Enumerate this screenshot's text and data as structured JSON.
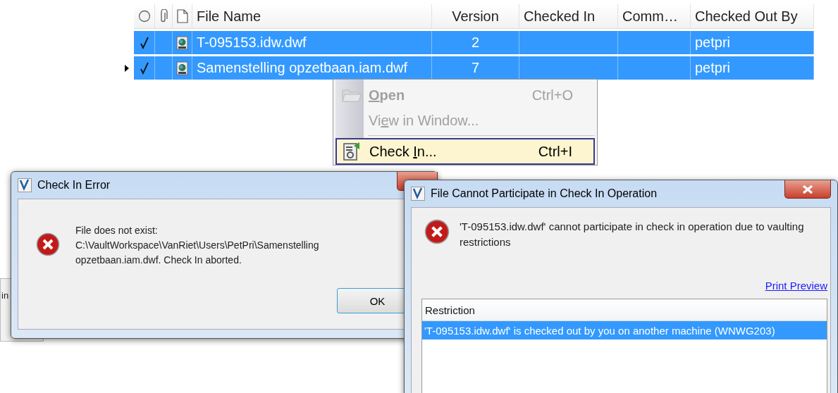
{
  "file_grid": {
    "columns": [
      "File Name",
      "Version",
      "Checked In",
      "Comm…",
      "Checked Out By"
    ],
    "rows": [
      {
        "checked": true,
        "current": false,
        "selected": true,
        "cells": [
          "T-095153.idw.dwf",
          "2",
          "",
          "",
          "petpri"
        ]
      },
      {
        "checked": true,
        "current": true,
        "selected": true,
        "cells": [
          "Samenstelling opzetbaan.iam.dwf",
          "7",
          "",
          "",
          "petpri"
        ]
      }
    ]
  },
  "context_menu": {
    "items": [
      {
        "kind": "item",
        "label": {
          "access_key": "O",
          "after": "pen"
        },
        "shortcut": "Ctrl+O",
        "disabled": true,
        "bold": true,
        "highlighted": false
      },
      {
        "kind": "item",
        "label": {
          "before": "Vi",
          "access_key": "e",
          "after": "w in Window..."
        },
        "disabled": true,
        "bold": false,
        "highlighted": false
      },
      {
        "kind": "separator"
      },
      {
        "kind": "item",
        "label": {
          "before": "Check ",
          "access_key": "I",
          "after": "n..."
        },
        "shortcut": "Ctrl+I",
        "disabled": false,
        "bold": false,
        "highlighted": true
      }
    ]
  },
  "background_window": {
    "text": "in"
  },
  "check_in_error": {
    "title": "Check In Error",
    "message": [
      "File does not exist:",
      "C:\\VaultWorkspace\\VanRiet\\Users\\PetPri\\Samenstelling",
      "opzetbaan.iam.dwf. Check In aborted."
    ],
    "button": "OK"
  },
  "participate_dialog": {
    "title": "File Cannot Participate in Check In Operation",
    "message": "'T-095153.idw.dwf' cannot participate in check in operation due to vaulting restrictions",
    "link": "Print Preview",
    "table": {
      "column": "Restriction",
      "rows": [
        {
          "text": "'T-095153.idw.dwf' is checked out by you on another machine (WNWG203)",
          "selected": true
        }
      ]
    }
  }
}
